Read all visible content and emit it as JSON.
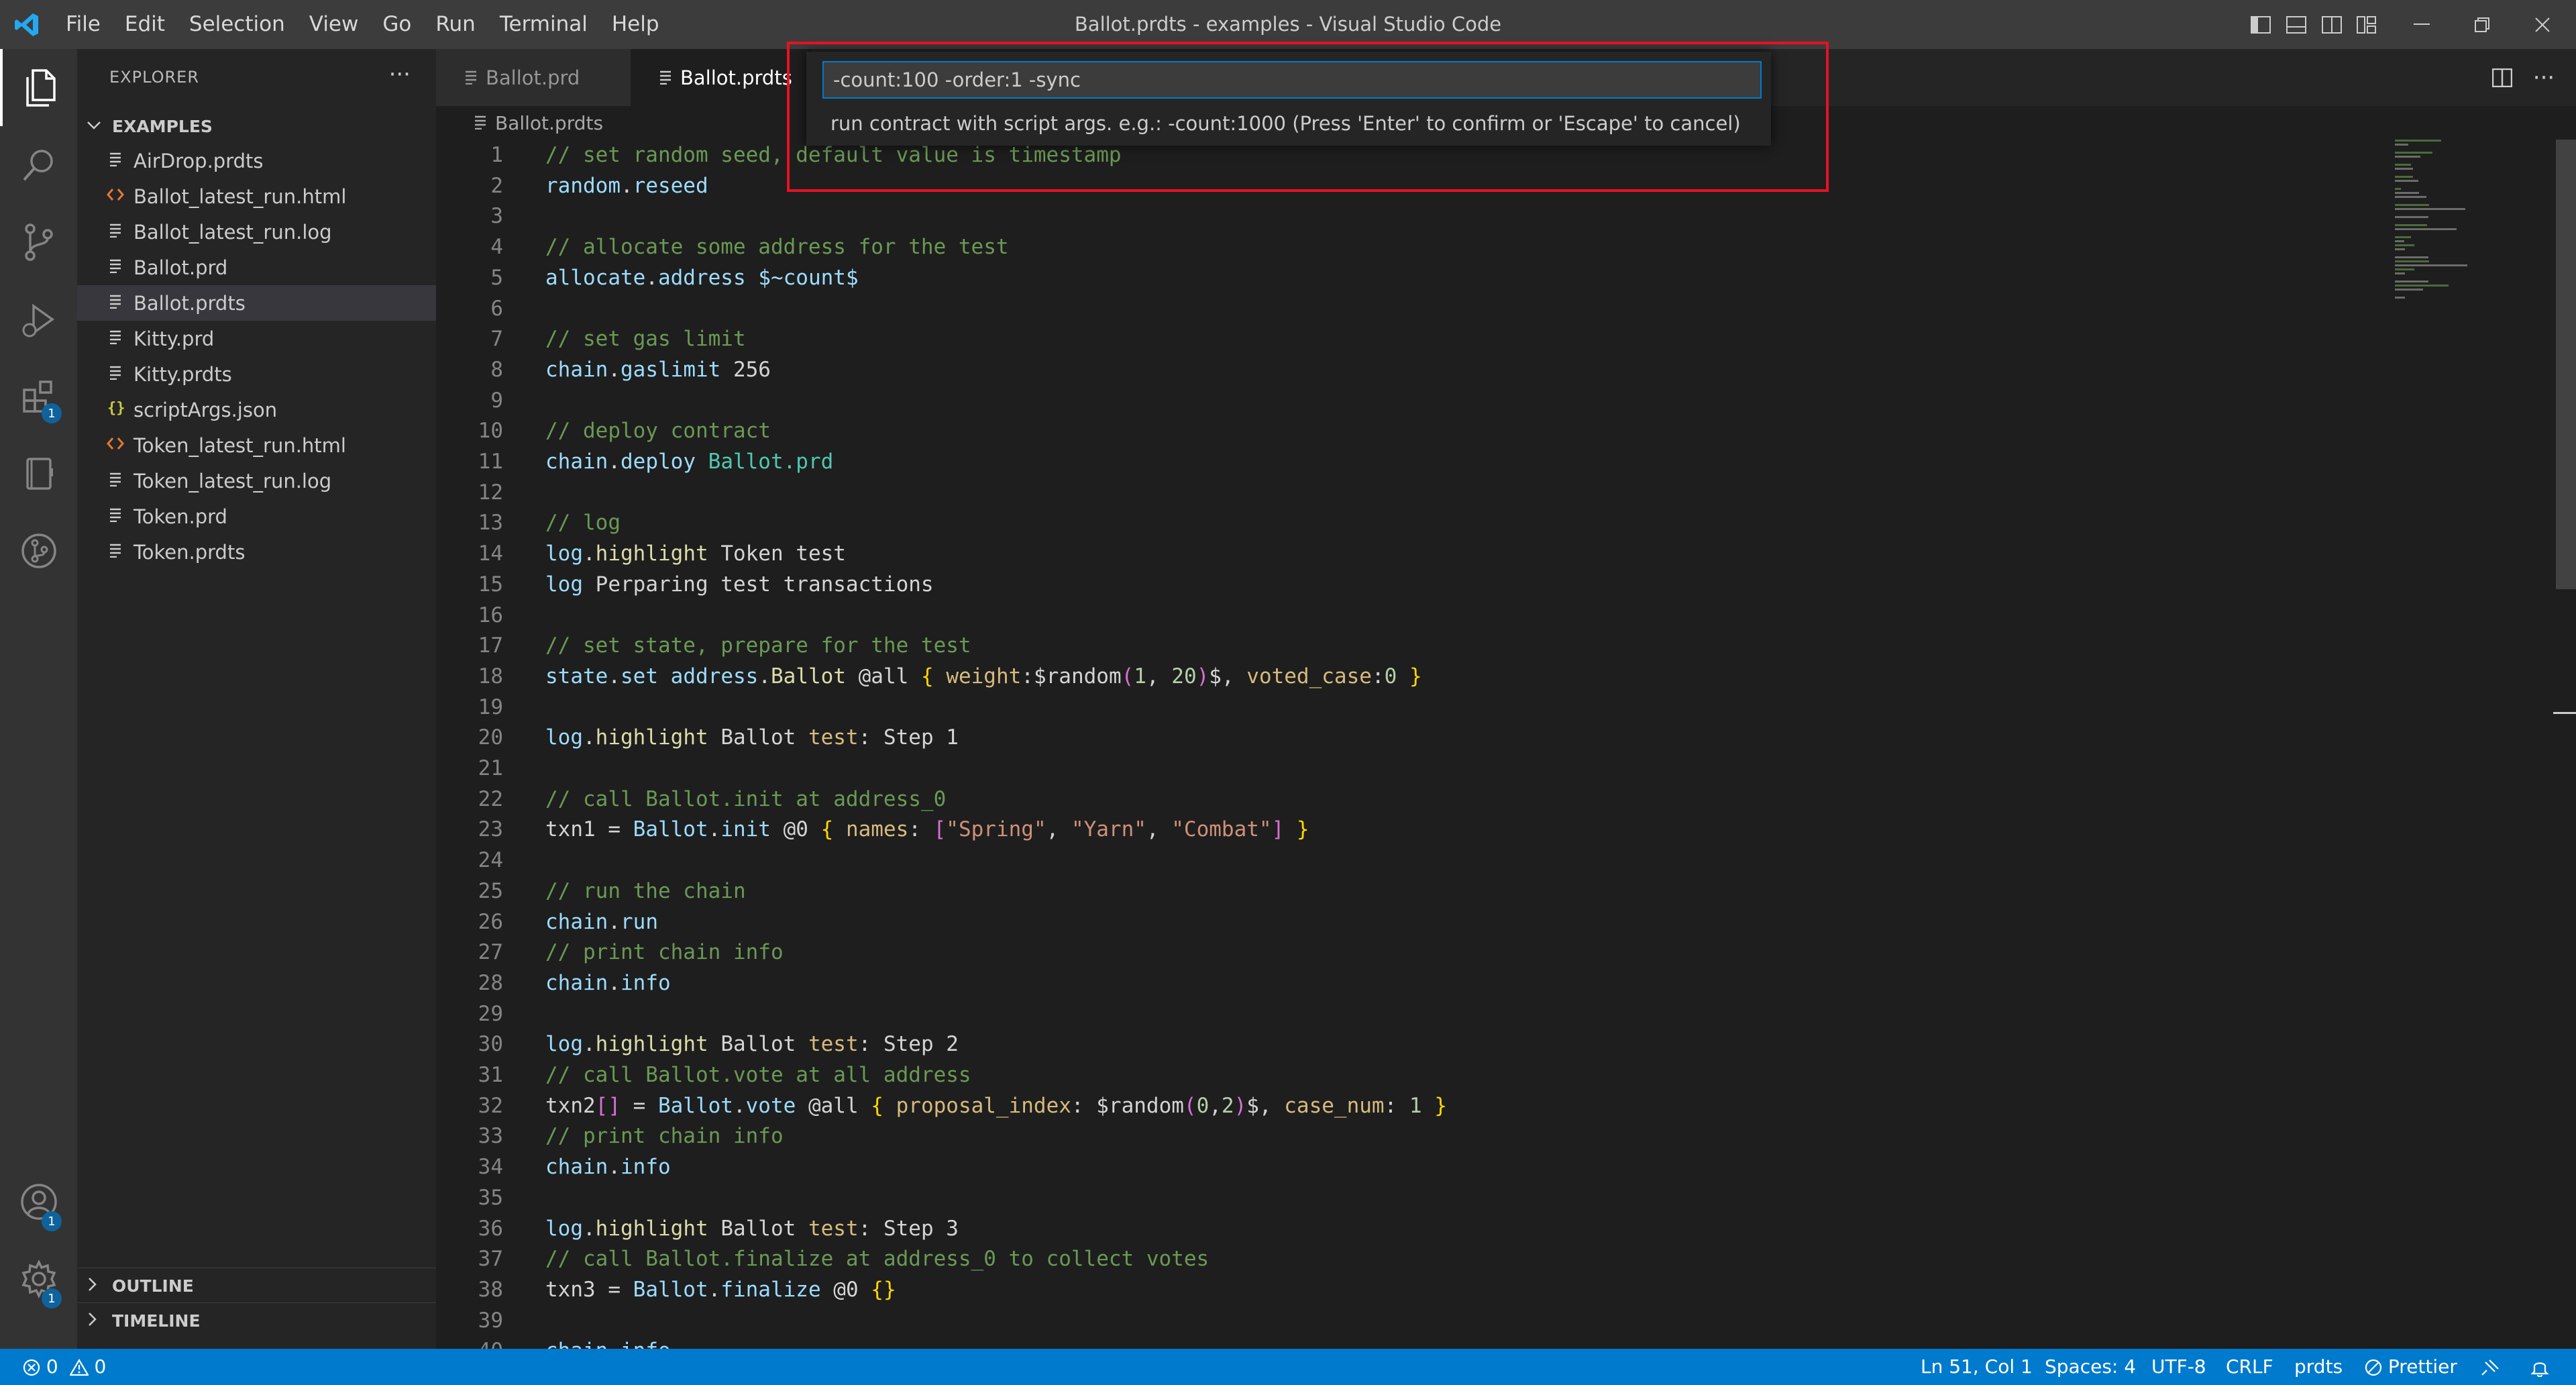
{
  "window": {
    "title": "Ballot.prdts - examples - Visual Studio Code"
  },
  "menu": [
    "File",
    "Edit",
    "Selection",
    "View",
    "Go",
    "Run",
    "Terminal",
    "Help"
  ],
  "sidebar": {
    "title": "EXPLORER",
    "more_label": "···",
    "folder": "EXAMPLES",
    "files": [
      {
        "name": "AirDrop.prdts",
        "icon": "file-lines-icon"
      },
      {
        "name": "Ballot_latest_run.html",
        "icon": "html-icon"
      },
      {
        "name": "Ballot_latest_run.log",
        "icon": "file-lines-icon"
      },
      {
        "name": "Ballot.prd",
        "icon": "file-lines-icon"
      },
      {
        "name": "Ballot.prdts",
        "icon": "file-lines-icon",
        "selected": true
      },
      {
        "name": "Kitty.prd",
        "icon": "file-lines-icon"
      },
      {
        "name": "Kitty.prdts",
        "icon": "file-lines-icon"
      },
      {
        "name": "scriptArgs.json",
        "icon": "json-braces-icon"
      },
      {
        "name": "Token_latest_run.html",
        "icon": "html-icon"
      },
      {
        "name": "Token_latest_run.log",
        "icon": "file-lines-icon"
      },
      {
        "name": "Token.prd",
        "icon": "file-lines-icon"
      },
      {
        "name": "Token.prdts",
        "icon": "file-lines-icon"
      }
    ],
    "outline": "OUTLINE",
    "timeline": "TIMELINE"
  },
  "activity": {
    "extensions_badge": "1",
    "accounts_badge": "1",
    "settings_badge": "1"
  },
  "tabs": [
    {
      "label": "Ballot.prd",
      "active": false
    },
    {
      "label": "Ballot.prdts",
      "active": true
    }
  ],
  "breadcrumb": "Ballot.prdts",
  "quick_input": {
    "value": "-count:100 -order:1 -sync",
    "message": "run contract with script args. e.g.: -count:1000 (Press 'Enter' to confirm or 'Escape' to cancel)"
  },
  "code": [
    {
      "n": "1",
      "t": [
        [
          "c-comment",
          "// set random seed, default value is timestamp"
        ]
      ]
    },
    {
      "n": "2",
      "t": [
        [
          "c-kw",
          "random"
        ],
        [
          "c-plain",
          "."
        ],
        [
          "c-kw",
          "reseed"
        ]
      ]
    },
    {
      "n": "3",
      "t": []
    },
    {
      "n": "4",
      "t": [
        [
          "c-comment",
          "// allocate some address for the test"
        ]
      ]
    },
    {
      "n": "5",
      "t": [
        [
          "c-kw",
          "allocate"
        ],
        [
          "c-plain",
          "."
        ],
        [
          "c-kw",
          "address"
        ],
        [
          "c-plain",
          " "
        ],
        [
          "c-kw",
          "$~count$"
        ]
      ]
    },
    {
      "n": "6",
      "t": []
    },
    {
      "n": "7",
      "t": [
        [
          "c-comment",
          "// set gas limit"
        ]
      ]
    },
    {
      "n": "8",
      "t": [
        [
          "c-kw",
          "chain"
        ],
        [
          "c-plain",
          "."
        ],
        [
          "c-kw",
          "gaslimit"
        ],
        [
          "c-plain",
          " 256"
        ]
      ]
    },
    {
      "n": "9",
      "t": []
    },
    {
      "n": "10",
      "t": [
        [
          "c-comment",
          "// deploy contract"
        ]
      ]
    },
    {
      "n": "11",
      "t": [
        [
          "c-kw",
          "chain"
        ],
        [
          "c-plain",
          "."
        ],
        [
          "c-kw",
          "deploy"
        ],
        [
          "c-plain",
          " "
        ],
        [
          "c-type",
          "Ballot.prd"
        ]
      ]
    },
    {
      "n": "12",
      "t": []
    },
    {
      "n": "13",
      "t": [
        [
          "c-comment",
          "// log"
        ]
      ]
    },
    {
      "n": "14",
      "t": [
        [
          "c-kw",
          "log"
        ],
        [
          "c-plain",
          "."
        ],
        [
          "c-fn",
          "highlight"
        ],
        [
          "c-plain",
          " Token test"
        ]
      ]
    },
    {
      "n": "15",
      "t": [
        [
          "c-kw",
          "log"
        ],
        [
          "c-plain",
          " Perparing test transactions"
        ]
      ]
    },
    {
      "n": "16",
      "t": []
    },
    {
      "n": "17",
      "t": [
        [
          "c-comment",
          "// set state, prepare for the test"
        ]
      ]
    },
    {
      "n": "18",
      "t": [
        [
          "c-kw",
          "state"
        ],
        [
          "c-plain",
          "."
        ],
        [
          "c-kw",
          "set"
        ],
        [
          "c-plain",
          " "
        ],
        [
          "c-kw",
          "address"
        ],
        [
          "c-plain",
          "."
        ],
        [
          "c-fn",
          "Ballot"
        ],
        [
          "c-plain",
          " @all "
        ],
        [
          "c-brace",
          "{"
        ],
        [
          "c-plain",
          " "
        ],
        [
          "c-prop",
          "weight"
        ],
        [
          "c-plain",
          ":$random"
        ],
        [
          "c-brack",
          "("
        ],
        [
          "c-num",
          "1"
        ],
        [
          "c-plain",
          ", "
        ],
        [
          "c-num",
          "20"
        ],
        [
          "c-brack",
          ")"
        ],
        [
          "c-plain",
          "$, "
        ],
        [
          "c-prop",
          "voted_case"
        ],
        [
          "c-plain",
          ":"
        ],
        [
          "c-num",
          "0"
        ],
        [
          "c-plain",
          " "
        ],
        [
          "c-brace",
          "}"
        ]
      ]
    },
    {
      "n": "19",
      "t": []
    },
    {
      "n": "20",
      "t": [
        [
          "c-kw",
          "log"
        ],
        [
          "c-plain",
          "."
        ],
        [
          "c-fn",
          "highlight"
        ],
        [
          "c-plain",
          " Ballot "
        ],
        [
          "c-prop",
          "test"
        ],
        [
          "c-plain",
          ": Step 1"
        ]
      ]
    },
    {
      "n": "21",
      "t": []
    },
    {
      "n": "22",
      "t": [
        [
          "c-comment",
          "// call Ballot.init at address_0"
        ]
      ]
    },
    {
      "n": "23",
      "t": [
        [
          "c-plain",
          "txn1 = "
        ],
        [
          "c-kw",
          "Ballot"
        ],
        [
          "c-plain",
          "."
        ],
        [
          "c-kw",
          "init"
        ],
        [
          "c-plain",
          " @0 "
        ],
        [
          "c-brace",
          "{"
        ],
        [
          "c-plain",
          " "
        ],
        [
          "c-prop",
          "names"
        ],
        [
          "c-plain",
          ": "
        ],
        [
          "c-brack",
          "["
        ],
        [
          "c-str",
          "\"Spring\""
        ],
        [
          "c-plain",
          ", "
        ],
        [
          "c-str",
          "\"Yarn\""
        ],
        [
          "c-plain",
          ", "
        ],
        [
          "c-str",
          "\"Combat\""
        ],
        [
          "c-brack",
          "]"
        ],
        [
          "c-plain",
          " "
        ],
        [
          "c-brace",
          "}"
        ]
      ]
    },
    {
      "n": "24",
      "t": []
    },
    {
      "n": "25",
      "t": [
        [
          "c-comment",
          "// run the chain"
        ]
      ]
    },
    {
      "n": "26",
      "t": [
        [
          "c-kw",
          "chain"
        ],
        [
          "c-plain",
          "."
        ],
        [
          "c-kw",
          "run"
        ]
      ]
    },
    {
      "n": "27",
      "t": [
        [
          "c-comment",
          "// print chain info"
        ]
      ]
    },
    {
      "n": "28",
      "t": [
        [
          "c-kw",
          "chain"
        ],
        [
          "c-plain",
          "."
        ],
        [
          "c-kw",
          "info"
        ]
      ]
    },
    {
      "n": "29",
      "t": []
    },
    {
      "n": "30",
      "t": [
        [
          "c-kw",
          "log"
        ],
        [
          "c-plain",
          "."
        ],
        [
          "c-fn",
          "highlight"
        ],
        [
          "c-plain",
          " Ballot "
        ],
        [
          "c-prop",
          "test"
        ],
        [
          "c-plain",
          ": Step 2"
        ]
      ]
    },
    {
      "n": "31",
      "t": [
        [
          "c-comment",
          "// call Ballot.vote at all address"
        ]
      ]
    },
    {
      "n": "32",
      "t": [
        [
          "c-plain",
          "txn2"
        ],
        [
          "c-brack",
          "[]"
        ],
        [
          "c-plain",
          " = "
        ],
        [
          "c-kw",
          "Ballot"
        ],
        [
          "c-plain",
          "."
        ],
        [
          "c-kw",
          "vote"
        ],
        [
          "c-plain",
          " @all "
        ],
        [
          "c-brace",
          "{"
        ],
        [
          "c-plain",
          " "
        ],
        [
          "c-prop",
          "proposal_index"
        ],
        [
          "c-plain",
          ": $random"
        ],
        [
          "c-brack",
          "("
        ],
        [
          "c-num",
          "0"
        ],
        [
          "c-plain",
          ","
        ],
        [
          "c-num",
          "2"
        ],
        [
          "c-brack",
          ")"
        ],
        [
          "c-plain",
          "$, "
        ],
        [
          "c-prop",
          "case_num"
        ],
        [
          "c-plain",
          ": "
        ],
        [
          "c-num",
          "1"
        ],
        [
          "c-plain",
          " "
        ],
        [
          "c-brace",
          "}"
        ]
      ]
    },
    {
      "n": "33",
      "t": [
        [
          "c-comment",
          "// print chain info"
        ]
      ]
    },
    {
      "n": "34",
      "t": [
        [
          "c-kw",
          "chain"
        ],
        [
          "c-plain",
          "."
        ],
        [
          "c-kw",
          "info"
        ]
      ]
    },
    {
      "n": "35",
      "t": []
    },
    {
      "n": "36",
      "t": [
        [
          "c-kw",
          "log"
        ],
        [
          "c-plain",
          "."
        ],
        [
          "c-fn",
          "highlight"
        ],
        [
          "c-plain",
          " Ballot "
        ],
        [
          "c-prop",
          "test"
        ],
        [
          "c-plain",
          ": Step 3"
        ]
      ]
    },
    {
      "n": "37",
      "t": [
        [
          "c-comment",
          "// call Ballot.finalize at address_0 to collect votes"
        ]
      ]
    },
    {
      "n": "38",
      "t": [
        [
          "c-plain",
          "txn3 = "
        ],
        [
          "c-kw",
          "Ballot"
        ],
        [
          "c-plain",
          "."
        ],
        [
          "c-kw",
          "finalize"
        ],
        [
          "c-plain",
          " @0 "
        ],
        [
          "c-brace",
          "{}"
        ]
      ]
    },
    {
      "n": "39",
      "t": []
    },
    {
      "n": "40",
      "t": [
        [
          "c-kw",
          "chain"
        ],
        [
          "c-plain",
          "."
        ],
        [
          "c-kw",
          "info"
        ]
      ]
    }
  ],
  "status": {
    "errors": "0",
    "warnings": "0",
    "position": "Ln 51, Col 1",
    "spaces": "Spaces: 4",
    "encoding": "UTF-8",
    "eol": "CRLF",
    "language": "prdts",
    "prettier": "Prettier"
  },
  "colors": {
    "accent": "#007acc",
    "highlight_box": "#e81123"
  }
}
